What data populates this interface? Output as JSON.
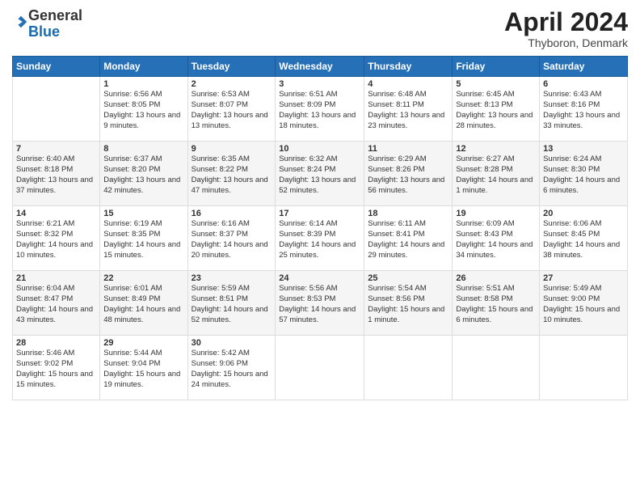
{
  "logo": {
    "general": "General",
    "blue": "Blue"
  },
  "header": {
    "month": "April 2024",
    "location": "Thyboron, Denmark"
  },
  "weekdays": [
    "Sunday",
    "Monday",
    "Tuesday",
    "Wednesday",
    "Thursday",
    "Friday",
    "Saturday"
  ],
  "weeks": [
    [
      {
        "day": "",
        "sunrise": "",
        "sunset": "",
        "daylight": ""
      },
      {
        "day": "1",
        "sunrise": "Sunrise: 6:56 AM",
        "sunset": "Sunset: 8:05 PM",
        "daylight": "Daylight: 13 hours and 9 minutes."
      },
      {
        "day": "2",
        "sunrise": "Sunrise: 6:53 AM",
        "sunset": "Sunset: 8:07 PM",
        "daylight": "Daylight: 13 hours and 13 minutes."
      },
      {
        "day": "3",
        "sunrise": "Sunrise: 6:51 AM",
        "sunset": "Sunset: 8:09 PM",
        "daylight": "Daylight: 13 hours and 18 minutes."
      },
      {
        "day": "4",
        "sunrise": "Sunrise: 6:48 AM",
        "sunset": "Sunset: 8:11 PM",
        "daylight": "Daylight: 13 hours and 23 minutes."
      },
      {
        "day": "5",
        "sunrise": "Sunrise: 6:45 AM",
        "sunset": "Sunset: 8:13 PM",
        "daylight": "Daylight: 13 hours and 28 minutes."
      },
      {
        "day": "6",
        "sunrise": "Sunrise: 6:43 AM",
        "sunset": "Sunset: 8:16 PM",
        "daylight": "Daylight: 13 hours and 33 minutes."
      }
    ],
    [
      {
        "day": "7",
        "sunrise": "Sunrise: 6:40 AM",
        "sunset": "Sunset: 8:18 PM",
        "daylight": "Daylight: 13 hours and 37 minutes."
      },
      {
        "day": "8",
        "sunrise": "Sunrise: 6:37 AM",
        "sunset": "Sunset: 8:20 PM",
        "daylight": "Daylight: 13 hours and 42 minutes."
      },
      {
        "day": "9",
        "sunrise": "Sunrise: 6:35 AM",
        "sunset": "Sunset: 8:22 PM",
        "daylight": "Daylight: 13 hours and 47 minutes."
      },
      {
        "day": "10",
        "sunrise": "Sunrise: 6:32 AM",
        "sunset": "Sunset: 8:24 PM",
        "daylight": "Daylight: 13 hours and 52 minutes."
      },
      {
        "day": "11",
        "sunrise": "Sunrise: 6:29 AM",
        "sunset": "Sunset: 8:26 PM",
        "daylight": "Daylight: 13 hours and 56 minutes."
      },
      {
        "day": "12",
        "sunrise": "Sunrise: 6:27 AM",
        "sunset": "Sunset: 8:28 PM",
        "daylight": "Daylight: 14 hours and 1 minute."
      },
      {
        "day": "13",
        "sunrise": "Sunrise: 6:24 AM",
        "sunset": "Sunset: 8:30 PM",
        "daylight": "Daylight: 14 hours and 6 minutes."
      }
    ],
    [
      {
        "day": "14",
        "sunrise": "Sunrise: 6:21 AM",
        "sunset": "Sunset: 8:32 PM",
        "daylight": "Daylight: 14 hours and 10 minutes."
      },
      {
        "day": "15",
        "sunrise": "Sunrise: 6:19 AM",
        "sunset": "Sunset: 8:35 PM",
        "daylight": "Daylight: 14 hours and 15 minutes."
      },
      {
        "day": "16",
        "sunrise": "Sunrise: 6:16 AM",
        "sunset": "Sunset: 8:37 PM",
        "daylight": "Daylight: 14 hours and 20 minutes."
      },
      {
        "day": "17",
        "sunrise": "Sunrise: 6:14 AM",
        "sunset": "Sunset: 8:39 PM",
        "daylight": "Daylight: 14 hours and 25 minutes."
      },
      {
        "day": "18",
        "sunrise": "Sunrise: 6:11 AM",
        "sunset": "Sunset: 8:41 PM",
        "daylight": "Daylight: 14 hours and 29 minutes."
      },
      {
        "day": "19",
        "sunrise": "Sunrise: 6:09 AM",
        "sunset": "Sunset: 8:43 PM",
        "daylight": "Daylight: 14 hours and 34 minutes."
      },
      {
        "day": "20",
        "sunrise": "Sunrise: 6:06 AM",
        "sunset": "Sunset: 8:45 PM",
        "daylight": "Daylight: 14 hours and 38 minutes."
      }
    ],
    [
      {
        "day": "21",
        "sunrise": "Sunrise: 6:04 AM",
        "sunset": "Sunset: 8:47 PM",
        "daylight": "Daylight: 14 hours and 43 minutes."
      },
      {
        "day": "22",
        "sunrise": "Sunrise: 6:01 AM",
        "sunset": "Sunset: 8:49 PM",
        "daylight": "Daylight: 14 hours and 48 minutes."
      },
      {
        "day": "23",
        "sunrise": "Sunrise: 5:59 AM",
        "sunset": "Sunset: 8:51 PM",
        "daylight": "Daylight: 14 hours and 52 minutes."
      },
      {
        "day": "24",
        "sunrise": "Sunrise: 5:56 AM",
        "sunset": "Sunset: 8:53 PM",
        "daylight": "Daylight: 14 hours and 57 minutes."
      },
      {
        "day": "25",
        "sunrise": "Sunrise: 5:54 AM",
        "sunset": "Sunset: 8:56 PM",
        "daylight": "Daylight: 15 hours and 1 minute."
      },
      {
        "day": "26",
        "sunrise": "Sunrise: 5:51 AM",
        "sunset": "Sunset: 8:58 PM",
        "daylight": "Daylight: 15 hours and 6 minutes."
      },
      {
        "day": "27",
        "sunrise": "Sunrise: 5:49 AM",
        "sunset": "Sunset: 9:00 PM",
        "daylight": "Daylight: 15 hours and 10 minutes."
      }
    ],
    [
      {
        "day": "28",
        "sunrise": "Sunrise: 5:46 AM",
        "sunset": "Sunset: 9:02 PM",
        "daylight": "Daylight: 15 hours and 15 minutes."
      },
      {
        "day": "29",
        "sunrise": "Sunrise: 5:44 AM",
        "sunset": "Sunset: 9:04 PM",
        "daylight": "Daylight: 15 hours and 19 minutes."
      },
      {
        "day": "30",
        "sunrise": "Sunrise: 5:42 AM",
        "sunset": "Sunset: 9:06 PM",
        "daylight": "Daylight: 15 hours and 24 minutes."
      },
      {
        "day": "",
        "sunrise": "",
        "sunset": "",
        "daylight": ""
      },
      {
        "day": "",
        "sunrise": "",
        "sunset": "",
        "daylight": ""
      },
      {
        "day": "",
        "sunrise": "",
        "sunset": "",
        "daylight": ""
      },
      {
        "day": "",
        "sunrise": "",
        "sunset": "",
        "daylight": ""
      }
    ]
  ]
}
